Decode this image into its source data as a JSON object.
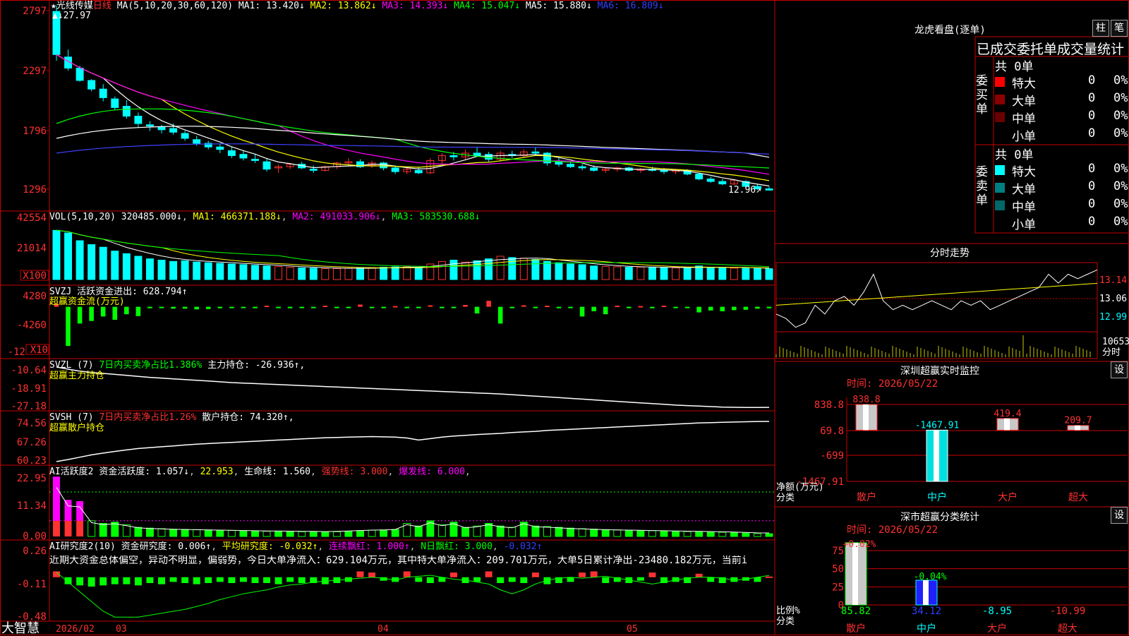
{
  "colors": {
    "up": "#ff3232",
    "down": "#00ffff",
    "grid": "#c80000",
    "ma1": "#ffffff",
    "ma2": "#ffff00",
    "ma3": "#ff00ff",
    "ma4": "#00ff00",
    "ma5": "#4040ff",
    "green": "#00ff00",
    "magenta": "#ff00ff"
  },
  "main_chart": {
    "stock_name": "光线传媒",
    "period": "日线",
    "ma_header": "MA(5,10,20,30,60,120)",
    "ma_values": [
      {
        "label": "MA1: 13.420↓",
        "color": "#ffffff"
      },
      {
        "label": "MA2: 13.862↓",
        "color": "#ffff00"
      },
      {
        "label": "MA3: 14.393↓",
        "color": "#ff00ff"
      },
      {
        "label": "MA4: 15.047↓",
        "color": "#00ff00"
      },
      {
        "label": "MA5: 15.880↓",
        "color": "#ffffff"
      },
      {
        "label": "MA6: 16.809↓",
        "color": "#3040ff"
      }
    ],
    "y_ticks": [
      "2797",
      "2297",
      "1796",
      "1296"
    ],
    "high_label": "27.97",
    "low_label": "12.96"
  },
  "vol_panel": {
    "header": "VOL(5,10,20)",
    "value": "320485.000↓",
    "ma1": "MA1: 466371.188↓",
    "ma2": "MA2: 491033.906↓",
    "ma3": "MA3: 583530.688↓",
    "y_ticks": [
      "42554",
      "21014"
    ],
    "unit": "X100"
  },
  "svzj_panel": {
    "header": "SVZJ",
    "label": "活跃资金进出: 628.794↑",
    "title": "超赢资金流(万元)",
    "y_ticks": [
      "4280",
      "-4260",
      "-12"
    ],
    "unit": "X10"
  },
  "svzl_panel": {
    "header": "SVZL (7)",
    "ratio": "7日内买卖净占比1.386%",
    "hold": "主力持仓: -26.936↑,",
    "title": "超赢主力持仓",
    "y_ticks": [
      "-10.64",
      "-18.91",
      "-27.18"
    ]
  },
  "svsh_panel": {
    "header": "SVSH (7)",
    "ratio": "7日内买卖净占比1.26%",
    "hold": "散户持仓: 74.320↑,",
    "title": "超赢散户持仓",
    "y_ticks": [
      "74.56",
      "67.26",
      "60.23"
    ]
  },
  "ai_active": {
    "header": "AI活跃度2",
    "act": "资金活跃度: 1.057↓",
    "v2": "22.953",
    "life": "生命线: 1.560",
    "strong": "强势线: 3.000",
    "burst": "爆发线: 6.000",
    "y_ticks": [
      "22.95",
      "11.34",
      "0.00"
    ]
  },
  "ai_research": {
    "header": "AI研究度2(10)",
    "research": "资金研究度: 0.006↑",
    "avg": "平均研究度: -0.032↑",
    "red_lian": "连续飘红: 1.000↑",
    "n_red": "N日飘红: 3.000",
    "last": "-0.032↑",
    "comment": "近期大资金总体偏空，异动不明显，偏弱势，今日大单净流入：629.104万元，其中特大单净流入：209.701万元，大单5日累计净出-23480.182万元，当前i",
    "y_ticks": [
      "0.26",
      "-0.11",
      "-0.48"
    ]
  },
  "bottom_bar": {
    "brand": "大智慧",
    "date_label": "2026/02",
    "months": [
      "03",
      "04",
      "05"
    ]
  },
  "chart_data": [
    {
      "type": "candlestick",
      "title": "光线传媒 日线",
      "ylim": [
        12.96,
        27.97
      ],
      "ohlc": [
        [
          27.5,
          27.97,
          23.5,
          24.0
        ],
        [
          23.8,
          24.4,
          22.7,
          22.9
        ],
        [
          22.9,
          23.1,
          21.8,
          21.9
        ],
        [
          21.9,
          22.0,
          21.0,
          21.2
        ],
        [
          21.2,
          21.6,
          20.2,
          20.5
        ],
        [
          20.4,
          20.6,
          19.5,
          19.7
        ],
        [
          19.8,
          20.3,
          18.8,
          19.0
        ],
        [
          19.0,
          19.3,
          18.1,
          18.4
        ],
        [
          18.3,
          18.6,
          17.8,
          18.2
        ],
        [
          18.1,
          18.3,
          17.6,
          17.9
        ],
        [
          18.0,
          18.4,
          17.5,
          17.7
        ],
        [
          17.6,
          17.8,
          17.0,
          17.2
        ],
        [
          17.1,
          17.4,
          16.6,
          16.8
        ],
        [
          16.8,
          17.0,
          16.3,
          16.5
        ],
        [
          16.5,
          16.8,
          16.0,
          16.3
        ],
        [
          16.2,
          16.5,
          15.6,
          15.8
        ],
        [
          15.9,
          16.2,
          15.4,
          15.6
        ],
        [
          15.5,
          15.9,
          15.2,
          15.4
        ],
        [
          15.3,
          15.6,
          14.5,
          14.7
        ],
        [
          14.8,
          15.1,
          14.4,
          14.9
        ],
        [
          14.9,
          15.2,
          14.7,
          15.1
        ],
        [
          15.1,
          15.3,
          14.7,
          14.8
        ],
        [
          14.7,
          15.0,
          14.4,
          14.6
        ],
        [
          14.6,
          15.0,
          14.5,
          14.9
        ],
        [
          14.9,
          15.3,
          14.7,
          15.2
        ],
        [
          15.2,
          15.6,
          15.0,
          15.3
        ],
        [
          15.3,
          15.5,
          14.8,
          14.9
        ],
        [
          15.0,
          15.4,
          14.8,
          15.2
        ],
        [
          15.2,
          15.3,
          14.6,
          14.8
        ],
        [
          14.8,
          15.0,
          14.3,
          14.5
        ],
        [
          14.5,
          14.8,
          14.3,
          14.7
        ],
        [
          14.6,
          14.9,
          14.3,
          14.4
        ],
        [
          14.4,
          15.6,
          14.3,
          15.4
        ],
        [
          15.4,
          16.0,
          15.1,
          15.8
        ],
        [
          15.8,
          16.1,
          15.4,
          15.7
        ],
        [
          15.7,
          16.3,
          15.5,
          16.0
        ],
        [
          16.0,
          16.5,
          15.7,
          15.8
        ],
        [
          15.9,
          16.1,
          15.3,
          15.5
        ],
        [
          15.5,
          16.2,
          15.3,
          16.0
        ],
        [
          15.9,
          16.2,
          15.6,
          15.8
        ],
        [
          15.8,
          16.3,
          15.6,
          16.1
        ],
        [
          16.1,
          16.5,
          15.8,
          16.0
        ],
        [
          16.0,
          16.1,
          15.0,
          15.2
        ],
        [
          15.3,
          15.6,
          14.9,
          15.1
        ],
        [
          15.1,
          15.3,
          14.8,
          14.9
        ],
        [
          14.9,
          15.1,
          14.6,
          14.8
        ],
        [
          14.8,
          15.0,
          14.5,
          14.6
        ],
        [
          14.6,
          14.8,
          14.4,
          14.7
        ],
        [
          14.7,
          14.9,
          14.5,
          14.8
        ],
        [
          14.8,
          14.9,
          14.5,
          14.6
        ],
        [
          14.6,
          14.8,
          14.4,
          14.7
        ],
        [
          14.7,
          14.9,
          14.5,
          14.6
        ],
        [
          14.6,
          14.8,
          14.3,
          14.5
        ],
        [
          14.5,
          14.7,
          14.3,
          14.6
        ],
        [
          14.6,
          14.7,
          14.2,
          14.3
        ],
        [
          14.3,
          14.4,
          13.8,
          13.9
        ],
        [
          13.9,
          14.1,
          13.6,
          13.7
        ],
        [
          13.7,
          13.9,
          13.4,
          13.5
        ],
        [
          13.5,
          13.9,
          13.4,
          13.8
        ],
        [
          13.7,
          13.8,
          13.2,
          13.3
        ],
        [
          13.3,
          13.5,
          13.0,
          13.1
        ],
        [
          13.1,
          13.3,
          12.96,
          13.0
        ]
      ],
      "ma": {
        "MA1": 13.42,
        "MA2": 13.862,
        "MA3": 14.393,
        "MA4": 15.047,
        "MA5": 15.88,
        "MA6": 16.809
      }
    },
    {
      "type": "bar",
      "title": "VOL(5,10,20)",
      "ylim": [
        0,
        42554
      ],
      "values": [
        38000,
        36000,
        30000,
        27000,
        25000,
        22000,
        20000,
        18000,
        16000,
        15000,
        14000,
        14500,
        13500,
        13000,
        12500,
        12000,
        11500,
        11000,
        10500,
        10000,
        9500,
        9000,
        8800,
        8500,
        8400,
        8600,
        9000,
        9200,
        9500,
        9800,
        10000,
        9500,
        12000,
        14000,
        15000,
        13500,
        14500,
        16000,
        18000,
        17000,
        16500,
        15500,
        14000,
        13000,
        12000,
        11500,
        10500,
        10000,
        9800,
        9500,
        9600,
        9400,
        9200,
        9000,
        8800,
        10500,
        9500,
        9300,
        8800,
        8700,
        8600,
        8400
      ]
    },
    {
      "type": "bar",
      "title": "超赢资金流(万元)",
      "ylim": [
        -12000,
        4280
      ],
      "values": [
        800,
        -10500,
        -4500,
        -3800,
        -2600,
        -3500,
        -2000,
        -2500,
        -400,
        -300,
        -500,
        -500,
        -700,
        -600,
        -400,
        -300,
        -300,
        -400,
        300,
        -300,
        -400,
        -300,
        -200,
        300,
        -300,
        -200,
        600,
        -300,
        -200,
        200,
        -300,
        -200,
        400,
        -300,
        -200,
        500,
        -1800,
        1600,
        -4500,
        -300,
        400,
        -200,
        300,
        -400,
        -300,
        -2600,
        -1200,
        -2000,
        300,
        -300,
        200,
        -400,
        300,
        -200,
        -300,
        -1500,
        -1000,
        -1200,
        -900,
        -800,
        -500,
        -400
      ]
    },
    {
      "type": "line",
      "title": "超赢主力持仓",
      "ylim": [
        -27.18,
        -10.64
      ],
      "values": [
        -10.6,
        -11.5,
        -12.3,
        -12.8,
        -13.2,
        -13.6,
        -14.0,
        -14.4,
        -14.8,
        -15.1,
        -15.4,
        -15.7,
        -16.0,
        -16.3,
        -16.6,
        -16.9,
        -17.1,
        -17.3,
        -17.5,
        -17.7,
        -17.9,
        -18.1,
        -18.3,
        -18.5,
        -18.7,
        -18.9,
        -19.1,
        -19.3,
        -19.5,
        -19.7,
        -19.9,
        -20.1,
        -20.3,
        -20.5,
        -20.7,
        -20.9,
        -21.1,
        -21.3,
        -21.5,
        -21.8,
        -22.1,
        -22.4,
        -22.7,
        -23.0,
        -23.3,
        -23.6,
        -23.9,
        -24.2,
        -24.5,
        -24.8,
        -25.1,
        -25.4,
        -25.7,
        -26.0,
        -26.2,
        -26.4,
        -26.6,
        -26.8,
        -26.9,
        -26.95,
        -26.94,
        -26.936
      ]
    },
    {
      "type": "line",
      "title": "超赢散户持仓",
      "ylim": [
        60.23,
        74.56
      ],
      "values": [
        60.5,
        61.2,
        62.0,
        62.8,
        63.4,
        64.0,
        64.5,
        65.0,
        65.3,
        65.6,
        65.9,
        66.2,
        66.5,
        66.7,
        66.9,
        67.1,
        67.3,
        67.5,
        67.7,
        67.9,
        68.1,
        68.3,
        68.5,
        68.7,
        68.8,
        68.9,
        69.0,
        69.1,
        69.0,
        68.9,
        68.6,
        67.9,
        68.4,
        68.9,
        69.3,
        69.5,
        69.8,
        70.0,
        70.2,
        70.5,
        70.7,
        70.9,
        71.2,
        71.4,
        71.6,
        71.8,
        72.0,
        72.2,
        72.4,
        72.6,
        72.8,
        73.0,
        73.2,
        73.4,
        73.6,
        73.8,
        73.9,
        74.0,
        74.1,
        74.2,
        74.3,
        74.32
      ]
    },
    {
      "type": "bar",
      "title": "AI活跃度2",
      "ylim": [
        0,
        22.95
      ],
      "values": [
        22.9,
        14.0,
        13.5,
        6.0,
        5.0,
        5.5,
        4.5,
        3.5,
        3.2,
        3.0,
        2.8,
        2.7,
        2.6,
        2.5,
        2.4,
        2.3,
        2.2,
        2.1,
        2.0,
        2.0,
        1.9,
        1.8,
        1.8,
        1.7,
        1.8,
        2.0,
        2.2,
        2.4,
        2.5,
        2.7,
        5.0,
        4.0,
        6.0,
        4.5,
        5.5,
        3.5,
        4.0,
        5.0,
        4.0,
        3.5,
        5.5,
        4.0,
        3.8,
        3.5,
        3.2,
        3.0,
        2.8,
        2.6,
        2.5,
        2.4,
        2.3,
        2.2,
        2.1,
        2.0,
        1.9,
        1.8,
        1.7,
        1.6,
        1.5,
        1.3,
        1.1,
        1.057
      ],
      "strong": 3.0,
      "burst": 6.0,
      "life": 1.56
    },
    {
      "type": "bar",
      "title": "AI研究度2(10)",
      "ylim": [
        -0.48,
        0.26
      ],
      "values": [
        0.05,
        -0.06,
        -0.07,
        -0.08,
        -0.07,
        -0.06,
        -0.06,
        -0.07,
        -0.05,
        -0.06,
        -0.04,
        -0.05,
        -0.06,
        -0.05,
        -0.04,
        -0.05,
        -0.04,
        -0.05,
        -0.05,
        -0.06,
        -0.04,
        -0.05,
        -0.05,
        -0.06,
        -0.05,
        -0.04,
        0.05,
        0.04,
        -0.03,
        -0.04,
        0.05,
        -0.04,
        -0.05,
        -0.04,
        0.04,
        -0.05,
        -0.04,
        0.05,
        -0.05,
        -0.04,
        -0.05,
        0.04,
        -0.06,
        -0.05,
        -0.04,
        0.04,
        0.05,
        -0.05,
        -0.04,
        -0.05,
        -0.03,
        0.04,
        -0.05,
        -0.04,
        -0.05,
        0.03,
        -0.04,
        -0.05,
        -0.04,
        -0.03,
        -0.04,
        0.006
      ],
      "avg": [
        0.0,
        -0.1,
        -0.2,
        -0.3,
        -0.4,
        -0.46,
        -0.46,
        -0.46,
        -0.44,
        -0.42,
        -0.4,
        -0.38,
        -0.35,
        -0.32,
        -0.28,
        -0.25,
        -0.22,
        -0.2,
        -0.18,
        -0.15,
        -0.13,
        -0.12,
        -0.1,
        -0.09,
        -0.08,
        -0.07,
        -0.06,
        -0.05,
        -0.06,
        -0.08,
        -0.05,
        -0.04,
        -0.03,
        -0.05,
        -0.07,
        -0.08,
        -0.1,
        -0.12,
        -0.18,
        -0.22,
        -0.18,
        -0.12,
        -0.08,
        -0.06,
        -0.05,
        -0.06,
        -0.05,
        -0.04,
        -0.06,
        -0.08,
        -0.1,
        -0.12,
        -0.1,
        -0.08,
        -0.06,
        -0.05,
        -0.05,
        -0.06,
        -0.08,
        -0.07,
        -0.05,
        -0.032
      ]
    },
    {
      "type": "line",
      "title": "分时走势",
      "ylim": [
        12.99,
        13.14
      ],
      "values": [
        13.03,
        13.02,
        13.0,
        13.01,
        13.05,
        13.03,
        13.06,
        13.07,
        13.05,
        13.08,
        13.12,
        13.06,
        13.04,
        13.05,
        13.04,
        13.05,
        13.06,
        13.05,
        13.04,
        13.06,
        13.05,
        13.06,
        13.04,
        13.05,
        13.06,
        13.07,
        13.08,
        13.09,
        13.12,
        13.1,
        13.12,
        13.11,
        13.12,
        13.13
      ]
    },
    {
      "type": "bar",
      "title": "深圳超赢实时监控",
      "categories": [
        "散户",
        "中户",
        "大户",
        "超大"
      ],
      "values": [
        838.8,
        -1467.91,
        419.4,
        209.7
      ],
      "ylim": [
        -1467.91,
        838.8
      ],
      "ylabel": "净额(万元)",
      "xlabel": "分类"
    },
    {
      "type": "bar",
      "title": "深市超赢分类统计",
      "categories": [
        "散户",
        "中户",
        "大户",
        "超大"
      ],
      "values": [
        85.82,
        34.12,
        -8.95,
        -10.99
      ],
      "ylim": [
        0,
        75
      ],
      "ylabel": "比例%",
      "xlabel": "分类",
      "annotations": [
        "+0.02%",
        "-0.04%"
      ]
    }
  ],
  "right_panel": {
    "lhb_title": "龙虎看盘(逐单)",
    "btn_col": "柱",
    "btn_pen": "笔",
    "table_header": "已成交委托单成交量统计",
    "buy_group": {
      "title": "委买单",
      "total": "共 0单",
      "rows": [
        {
          "name": "特大",
          "n": "0",
          "p": "0%",
          "color": "#ff0000"
        },
        {
          "name": "大单",
          "n": "0",
          "p": "0%",
          "color": "#8b0000"
        },
        {
          "name": "中单",
          "n": "0",
          "p": "0%",
          "color": "#6a0000"
        },
        {
          "name": "小单",
          "n": "0",
          "p": "0%",
          "color": ""
        }
      ]
    },
    "sell_group": {
      "title": "委卖单",
      "total": "共 0单",
      "rows": [
        {
          "name": "特大",
          "n": "0",
          "p": "0%",
          "color": "#00ffff"
        },
        {
          "name": "大单",
          "n": "0",
          "p": "0%",
          "color": "#008080"
        },
        {
          "name": "中单",
          "n": "0",
          "p": "0%",
          "color": "#006868"
        },
        {
          "name": "小单",
          "n": "0",
          "p": "0%",
          "color": ""
        }
      ]
    },
    "fs_title": "分时走势",
    "fs_ticks": [
      "13.14",
      "13.06",
      "12.99"
    ],
    "fs_vol": "10653",
    "fs_vol_unit": "分时",
    "sz_title": "深圳超赢实时监控",
    "sz_time": "时间: 2026/05/22",
    "sz_ticks": [
      "838.8",
      "69.8",
      "-699",
      "-1467.91"
    ],
    "sz_ylabel": "净额(万元)",
    "sz_xlabel": "分类",
    "sz_bar_labels": [
      "838.8",
      "-1467.91",
      "419.4",
      "209.7"
    ],
    "cats": [
      "散户",
      "中户",
      "大户",
      "超大"
    ],
    "ss_title": "深市超赢分类统计",
    "ss_time": "时间: 2026/05/22",
    "ss_ticks": [
      "75",
      "50",
      "25",
      "0"
    ],
    "ss_ylabel": "比例%",
    "ss_xlabel": "分类",
    "ss_bar_labels": [
      "85.82",
      "34.12",
      "-8.95",
      "-10.99"
    ],
    "ss_pct": [
      "+0.02%",
      "-0.04%"
    ],
    "set_btn": "设"
  }
}
